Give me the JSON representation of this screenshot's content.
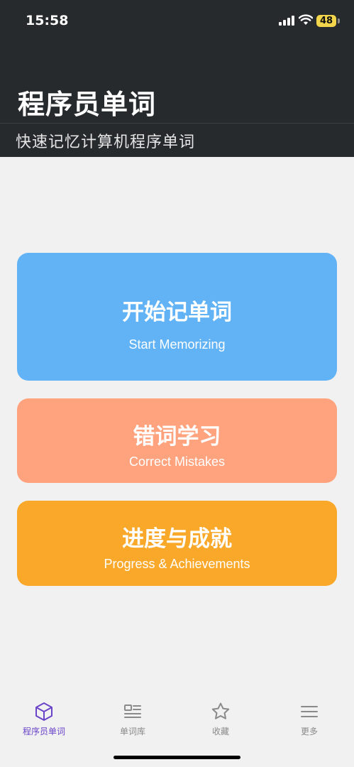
{
  "status_bar": {
    "time": "15:58",
    "battery": "48"
  },
  "header": {
    "title": "程序员单词",
    "subtitle": "快速记忆计算机程序单词"
  },
  "cards": [
    {
      "title": "开始记单词",
      "subtitle": "Start Memorizing",
      "color": "#62b3f6"
    },
    {
      "title": "错词学习",
      "subtitle": "Correct Mistakes",
      "color": "#ffa37e"
    },
    {
      "title": "进度与成就",
      "subtitle": "Progress & Achievements",
      "color": "#f9a82a"
    }
  ],
  "tabs": [
    {
      "label": "程序员单词",
      "icon": "cube-icon",
      "active": true
    },
    {
      "label": "单词库",
      "icon": "list-icon",
      "active": false
    },
    {
      "label": "收藏",
      "icon": "star-icon",
      "active": false
    },
    {
      "label": "更多",
      "icon": "menu-icon",
      "active": false
    }
  ],
  "colors": {
    "header_bg": "#262a2d",
    "page_bg": "#f1f1f1",
    "tab_active": "#6a44c8",
    "tab_inactive": "#8a8a8a"
  }
}
